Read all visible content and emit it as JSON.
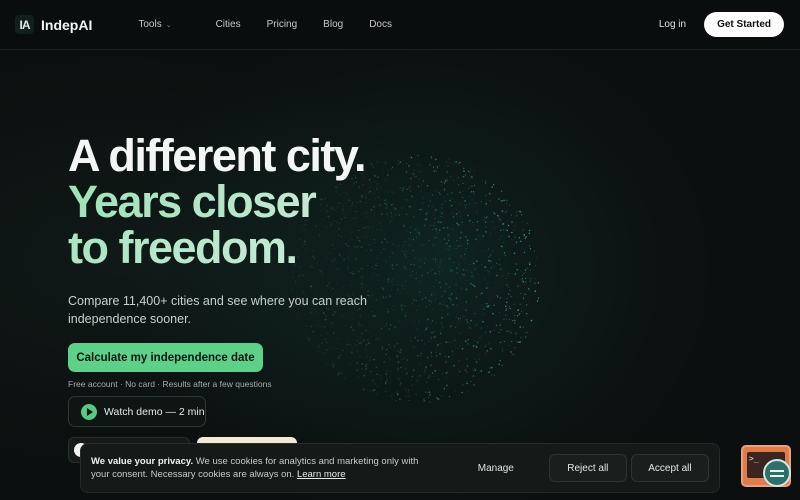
{
  "nav": {
    "logo_mark": "IA",
    "logo_text": "IndepAI",
    "links": [
      "Tools",
      "Cities",
      "Pricing",
      "Blog",
      "Docs"
    ],
    "login": "Log in",
    "get_started": "Get Started"
  },
  "hero": {
    "line1": "A different city.",
    "line2": "Years closer",
    "line3": "to freedom.",
    "subtitle": "Compare 11,400+ cities and see where you can reach independence sooner.",
    "cta": "Calculate my independence date",
    "fineprint": "Free account · No card · Results after a few questions",
    "demo": "Watch demo — 2 min"
  },
  "cookie": {
    "lead": "We value your privacy.",
    "text": " We use cookies for analytics and marketing only with your consent. Necessary cookies are always on. ",
    "learn_more": "Learn more",
    "manage": "Manage",
    "reject": "Reject all",
    "accept": "Accept all"
  },
  "colors": {
    "background": "#0b0f0f",
    "accent_green": "#5fd08a",
    "globe": "#4fd6b0"
  },
  "icons": {
    "play": "play-icon",
    "chevron": "chevron-down-icon",
    "chat_widget": "chat-widget-icon"
  }
}
